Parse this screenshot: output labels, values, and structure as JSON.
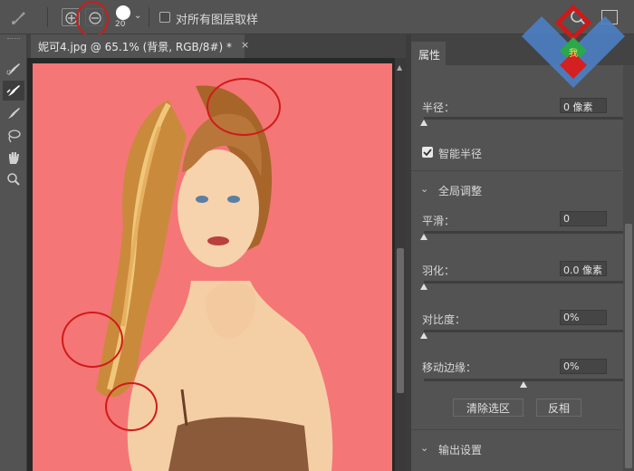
{
  "options_bar": {
    "brush_size": "20",
    "sample_all_layers_label": "对所有图层取样",
    "sample_all_layers_checked": false
  },
  "document": {
    "tab_title": "妮可4.jpg @ 65.1% (背景, RGB/8#) *",
    "close_glyph": "×",
    "canvas_overlay_color": "#f57676"
  },
  "properties": {
    "tab_label": "属性",
    "radius": {
      "label": "半径：",
      "value": "0 像素"
    },
    "smart_radius": {
      "label": "智能半径",
      "checked": true
    },
    "global_adjust": {
      "label": "全局调整"
    },
    "smooth": {
      "label": "平滑：",
      "value": "0"
    },
    "feather": {
      "label": "羽化：",
      "value": "0.0 像素"
    },
    "contrast": {
      "label": "对比度：",
      "value": "0%"
    },
    "shift_edge": {
      "label": "移动边缘：",
      "value": "0%"
    },
    "clear_selection_button": "清除选区",
    "invert_button": "反相",
    "output_settings": {
      "label": "输出设置"
    }
  },
  "logo": {
    "text": "我"
  },
  "colors": {
    "annotation_red": "#d11a1a",
    "panel_bg": "#535353",
    "canvas_bg": "#282828"
  }
}
